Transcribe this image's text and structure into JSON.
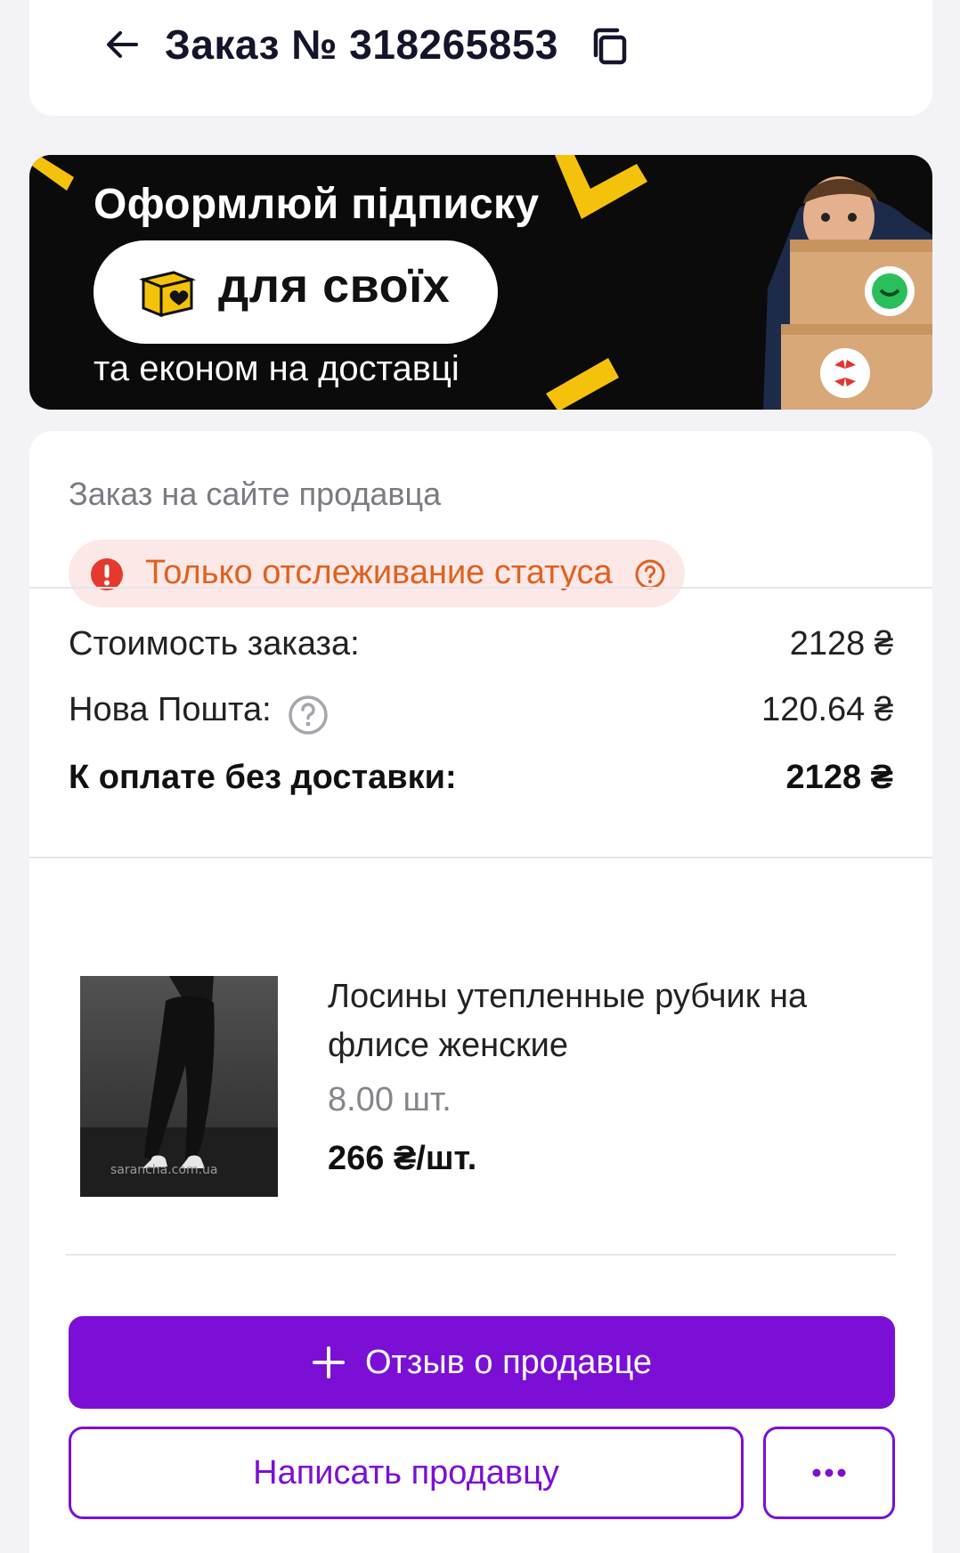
{
  "header": {
    "title": "Заказ № 318265853"
  },
  "banner": {
    "headline": "Оформлюй підписку",
    "pill_text": "для своїх",
    "subtitle": "та економ на доставці"
  },
  "order": {
    "seller_site_label": "Заказ на сайте продавца",
    "status_text": "Только отслеживание статуса",
    "summary": {
      "order_cost_label": "Стоимость заказа:",
      "order_cost_value": "2128 ₴",
      "nova_poshta_label": "Нова Пошта:",
      "nova_poshta_value": "120.64 ₴",
      "total_label": "К оплате без доставки:",
      "total_value": "2128 ₴"
    },
    "product": {
      "name": "Лосины утепленные рубчик на флисе женские",
      "quantity": "8.00 шт.",
      "price": "266 ₴/шт.",
      "image_watermark": "saranchа.com.ua"
    }
  },
  "actions": {
    "review_label": "Отзыв о продавце",
    "message_label": "Написать продавцу"
  },
  "colors": {
    "accent": "#7b0fd6",
    "status_bg": "#fde8e8",
    "status_text": "#e0611e",
    "banner_bg": "#0b0b0b",
    "banner_yellow": "#f5c20b"
  }
}
